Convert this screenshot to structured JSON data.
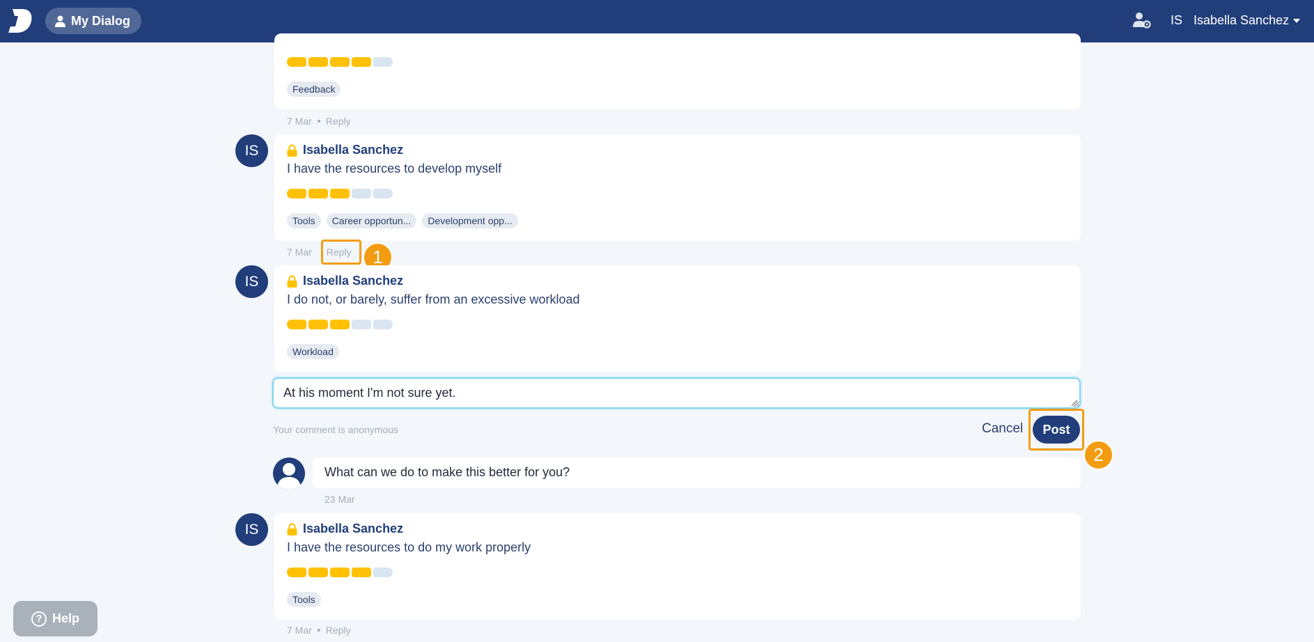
{
  "header": {
    "nav_button_label": "My Dialog",
    "user_initials": "IS",
    "user_name": "Isabella Sanchez"
  },
  "cards": [
    {
      "author": "",
      "statement": "",
      "rating": 4,
      "rating_max": 5,
      "tags": [
        "Feedback"
      ],
      "date": "7 Mar",
      "reply_label": "Reply"
    },
    {
      "author": "Isabella Sanchez",
      "initials": "IS",
      "statement": "I have the resources to develop myself",
      "rating": 3,
      "rating_max": 5,
      "tags": [
        "Tools",
        "Career opportun...",
        "Development opp..."
      ],
      "date": "7 Mar",
      "reply_label": "Reply"
    },
    {
      "author": "Isabella Sanchez",
      "initials": "IS",
      "statement": "I do not, or barely, suffer from an excessive workload",
      "rating": 3,
      "rating_max": 5,
      "tags": [
        "Workload"
      ]
    },
    {
      "author": "Isabella Sanchez",
      "initials": "IS",
      "statement": "I have the resources to do my work properly",
      "rating": 4,
      "rating_max": 5,
      "tags": [
        "Tools"
      ],
      "date": "7 Mar",
      "reply_label": "Reply"
    }
  ],
  "reply_form": {
    "value": "At his moment I'm not sure yet.",
    "anonymous_note": "Your comment is anonymous",
    "cancel_label": "Cancel",
    "post_label": "Post"
  },
  "manager_comment": {
    "text": "What can we do to make this better for you?",
    "date": "23 Mar"
  },
  "annotations": {
    "step1": "1",
    "step2": "2"
  },
  "help": {
    "label": "Help",
    "icon_glyph": "?"
  },
  "colors": {
    "header_bg": "#213e7a",
    "accent_orange": "#f39c12",
    "rating_on": "#ffc107",
    "rating_off": "#d9e5f1"
  }
}
